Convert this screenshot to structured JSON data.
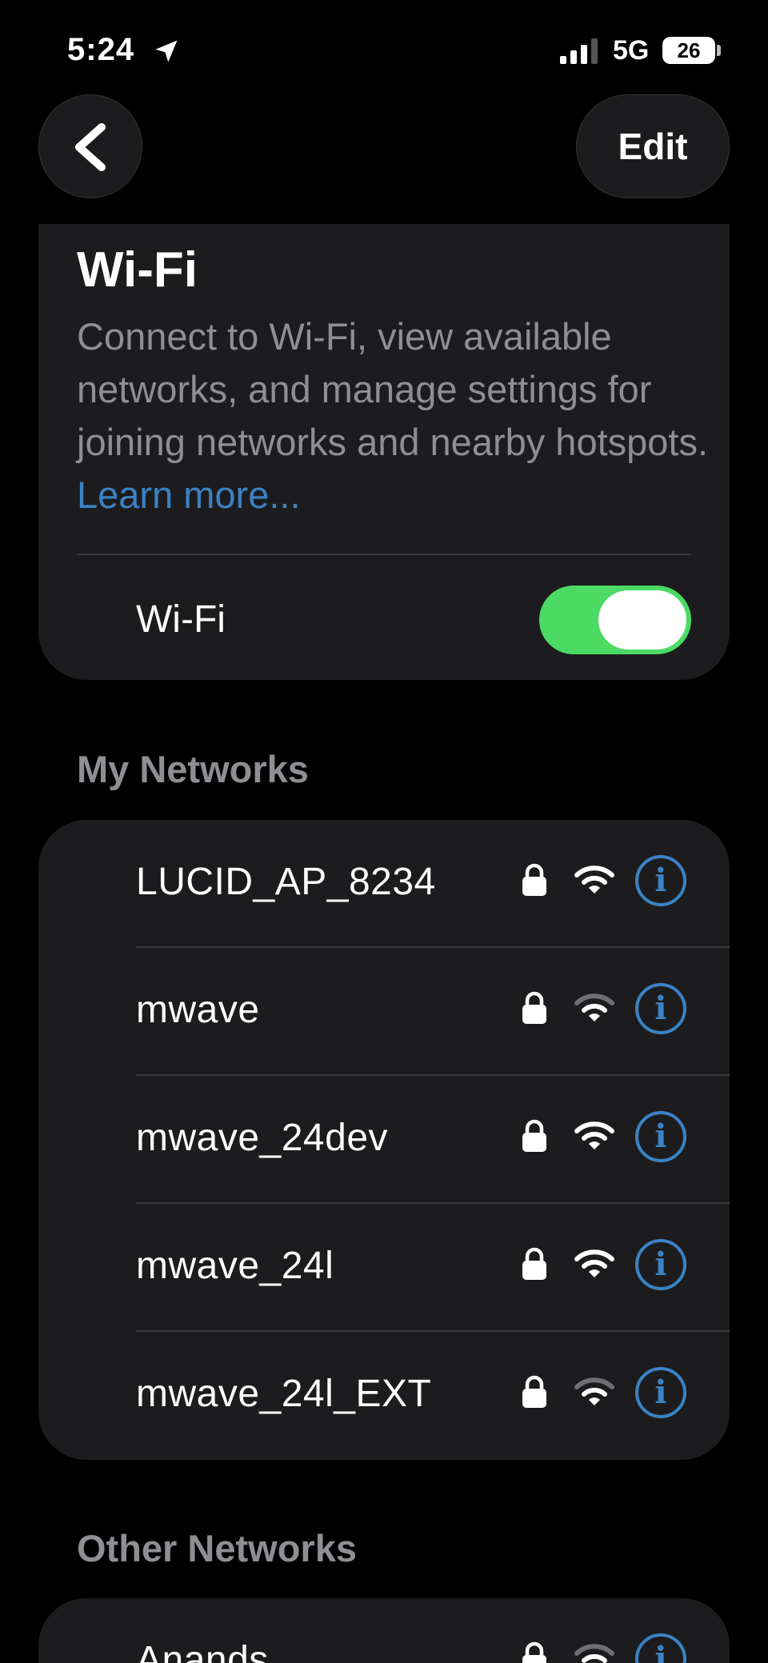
{
  "status_bar": {
    "time": "5:24",
    "network_type": "5G",
    "battery_level": "26",
    "icons": [
      "location-arrow-icon",
      "cellular-signal-icon",
      "battery-icon"
    ]
  },
  "nav": {
    "back_icon": "chevron-left-icon",
    "edit_label": "Edit"
  },
  "wifi_card": {
    "title": "Wi-Fi",
    "description": "Connect to Wi-Fi, view available networks, and manage settings for joining networks and nearby hotspots.",
    "learn_more": "Learn more...",
    "toggle_label": "Wi-Fi",
    "toggle_on": true,
    "toggle_color": "#4cd964"
  },
  "my_networks": {
    "header": "My Networks",
    "items": [
      {
        "name": "LUCID_AP_8234",
        "secured": true,
        "signal": "full"
      },
      {
        "name": "mwave",
        "secured": true,
        "signal": "medium"
      },
      {
        "name": "mwave_24dev",
        "secured": true,
        "signal": "full"
      },
      {
        "name": "mwave_24l",
        "secured": true,
        "signal": "full"
      },
      {
        "name": "mwave_24l_EXT",
        "secured": true,
        "signal": "medium"
      }
    ]
  },
  "other_networks": {
    "header": "Other Networks",
    "items": [
      {
        "name": "Anands",
        "secured": true,
        "signal": "medium"
      }
    ]
  },
  "colors": {
    "accent": "#3b82c4",
    "card_bg": "#1c1c1e",
    "secondary_text": "#8e8e93"
  }
}
